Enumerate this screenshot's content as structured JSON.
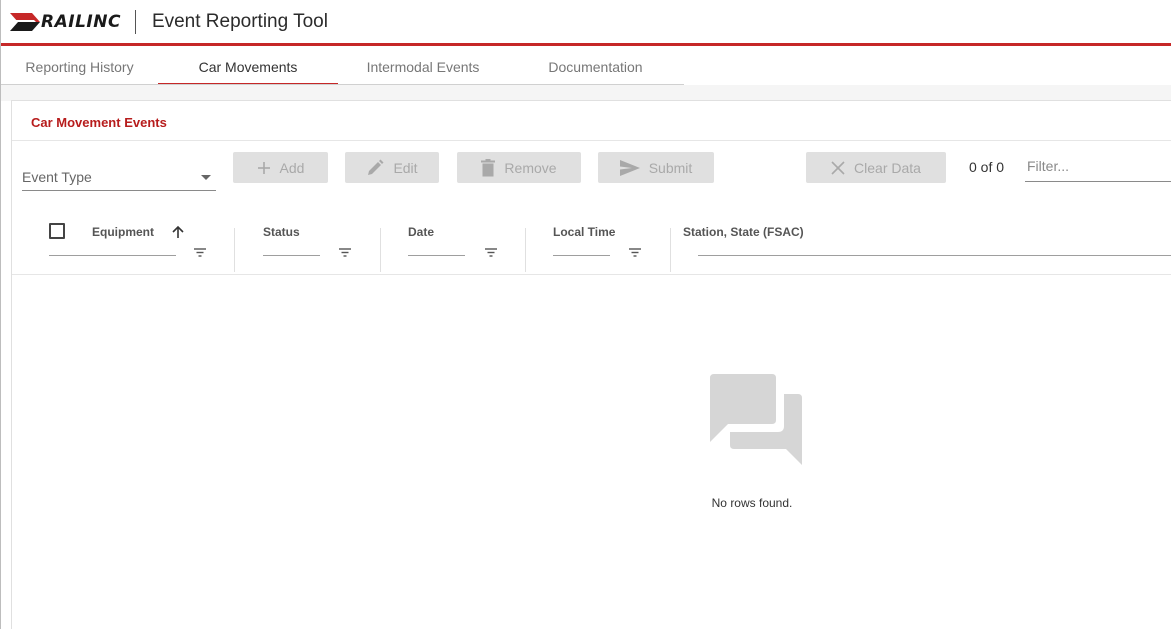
{
  "header": {
    "logo_text": "RAILINC",
    "app_title": "Event Reporting Tool",
    "brand_color": "#c62828"
  },
  "tabs": [
    {
      "label": "Reporting History",
      "active": false
    },
    {
      "label": "Car Movements",
      "active": true
    },
    {
      "label": "Intermodal Events",
      "active": false
    },
    {
      "label": "Documentation",
      "active": false
    }
  ],
  "panel": {
    "title": "Car Movement Events",
    "title_color": "#b71c1c"
  },
  "toolbar": {
    "event_type_label": "Event Type",
    "add_label": "Add",
    "edit_label": "Edit",
    "remove_label": "Remove",
    "submit_label": "Submit",
    "clear_label": "Clear Data",
    "count_text": "0 of 0",
    "filter_placeholder": "Filter..."
  },
  "grid": {
    "columns": [
      {
        "label": "Equipment",
        "sorted": "ascending"
      },
      {
        "label": "Status"
      },
      {
        "label": "Date"
      },
      {
        "label": "Local Time"
      },
      {
        "label": "Station, State (FSAC)"
      }
    ],
    "rows": [],
    "empty_message": "No rows found.",
    "icons": {
      "sort": "arrow-up-icon",
      "column_filter": "filter-lines-icon",
      "empty": "chat-bubbles-icon"
    }
  }
}
